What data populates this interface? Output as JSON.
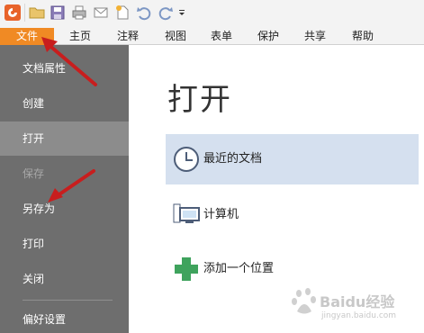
{
  "menu": {
    "items": [
      "文件",
      "主页",
      "注释",
      "视图",
      "表单",
      "保护",
      "共享",
      "帮助"
    ],
    "active_index": 0,
    "active_color": "#f08a24"
  },
  "toolbar": {
    "icons": [
      "app-logo-icon",
      "open-folder-icon",
      "save-icon",
      "print-icon",
      "email-icon",
      "new-document-icon",
      "undo-icon",
      "redo-icon",
      "customize-dropdown-icon"
    ]
  },
  "sidebar": {
    "items": [
      {
        "label": "文档属性",
        "state": "normal"
      },
      {
        "label": "创建",
        "state": "normal"
      },
      {
        "label": "打开",
        "state": "selected"
      },
      {
        "label": "保存",
        "state": "disabled"
      },
      {
        "label": "另存为",
        "state": "normal"
      },
      {
        "label": "打印",
        "state": "normal"
      },
      {
        "label": "关闭",
        "state": "normal"
      },
      {
        "label": "偏好设置",
        "state": "normal"
      }
    ]
  },
  "main": {
    "title": "打开",
    "options": [
      {
        "label": "最近的文档",
        "icon": "clock-icon",
        "selected": true
      },
      {
        "label": "计算机",
        "icon": "computer-icon",
        "selected": false
      },
      {
        "label": "添加一个位置",
        "icon": "plus-icon",
        "selected": false
      }
    ]
  },
  "watermark": {
    "text": "Baidu经验",
    "url": "jingyan.baidu.com"
  },
  "colors": {
    "sidebar_bg": "#6e6e6e",
    "sidebar_selected": "#8c8c8c",
    "option_selected_bg": "#d5e0ef",
    "plus_green": "#3fa35d",
    "annotation_red": "#c81e1e"
  }
}
